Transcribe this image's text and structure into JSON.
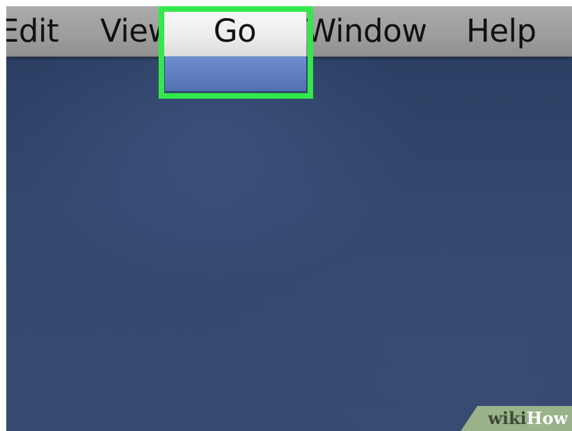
{
  "menubar": {
    "items": [
      {
        "label": "Edit"
      },
      {
        "label": "View"
      },
      {
        "label": "Go",
        "selected": true
      },
      {
        "label": "Window"
      },
      {
        "label": "Help"
      }
    ]
  },
  "highlight": {
    "color": "#32e84a",
    "target": "Go"
  },
  "watermark": {
    "wiki": "wiki",
    "how": "How"
  },
  "colors": {
    "desktop": "#34466c",
    "menubar": "#9d9d9d",
    "selected_menu": "#eeeeee",
    "dropdown": "#5f7fc2"
  }
}
